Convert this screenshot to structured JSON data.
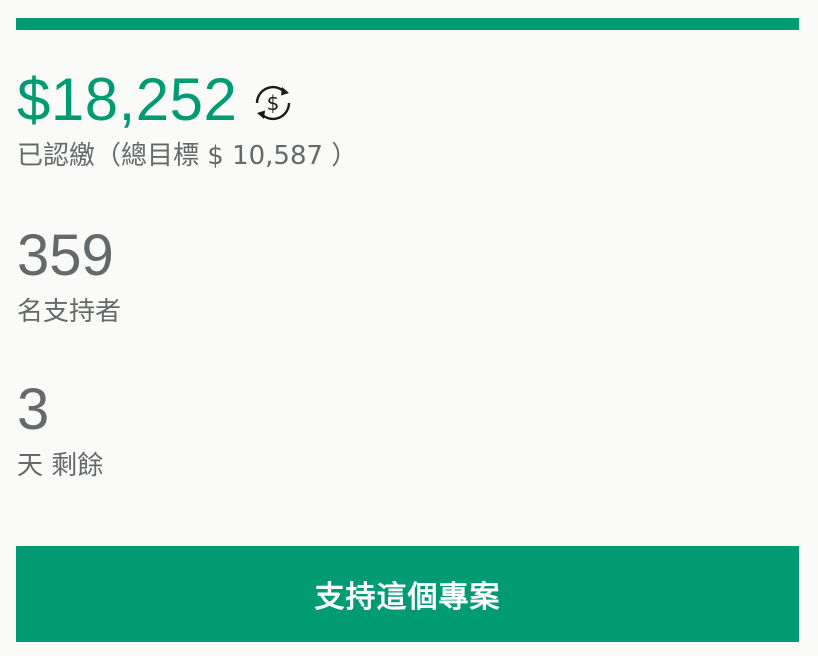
{
  "progress": {
    "percent": 100,
    "color": "#009b73"
  },
  "pledged": {
    "amount": "$18,252",
    "currency_icon": "currency-conversion-icon",
    "subtitle": "已認繳（總目標 $ 10,587 ）"
  },
  "backers": {
    "count": "359",
    "label": "名支持者"
  },
  "time_left": {
    "count": "3",
    "label": "天 剩餘"
  },
  "cta": {
    "label": "支持這個專案",
    "color": "#009b73"
  }
}
